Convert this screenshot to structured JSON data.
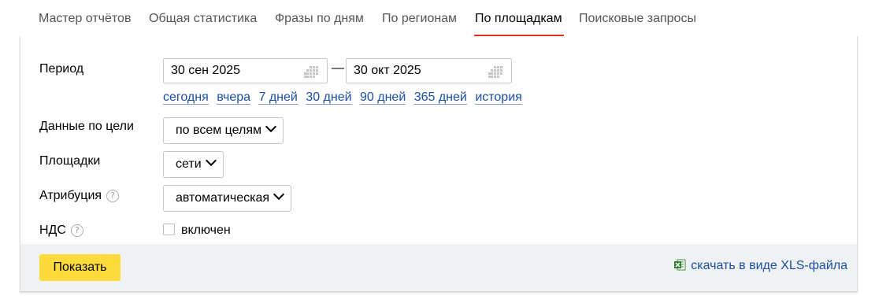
{
  "tabs": [
    {
      "label": "Мастер отчётов",
      "active": false
    },
    {
      "label": "Общая статистика",
      "active": false
    },
    {
      "label": "Фразы по дням",
      "active": false
    },
    {
      "label": "По регионам",
      "active": false
    },
    {
      "label": "По площадкам",
      "active": true
    },
    {
      "label": "Поисковые запросы",
      "active": false
    }
  ],
  "form": {
    "period_label": "Период",
    "date_from": "30 сен 2025",
    "date_to": "30 окт 2025",
    "date_separator": "—",
    "quick_ranges": [
      "сегодня",
      "вчера",
      "7 дней",
      "30 дней",
      "90 дней",
      "365 дней",
      "история"
    ],
    "goal_label": "Данные по цели",
    "goal_value": "по всем целям",
    "placements_label": "Площадки",
    "placements_value": "сети",
    "attribution_label": "Атрибуция",
    "attribution_value": "автоматическая",
    "vat_label": "НДС",
    "vat_checkbox_label": "включен",
    "vat_checked": false,
    "help_glyph": "?"
  },
  "footer": {
    "show_button": "Показать",
    "xls_link": "скачать в виде XLS-файла"
  },
  "colors": {
    "active_tab_underline": "#e52e2e",
    "link": "#1a4fa5",
    "primary_button": "#fddb3a",
    "footer_bg": "#f0f1f3"
  }
}
